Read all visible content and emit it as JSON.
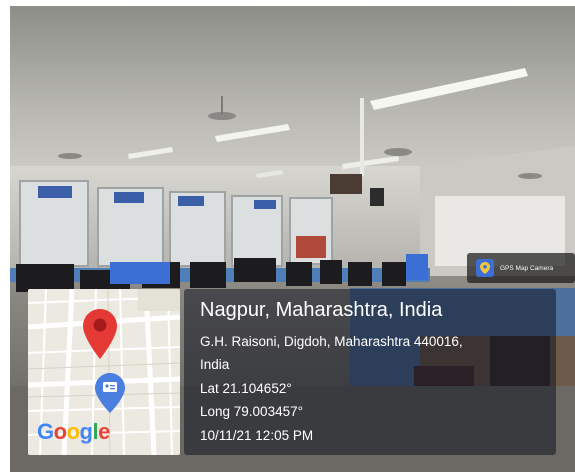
{
  "camera_badge": {
    "label": "GPS Map Camera",
    "icon": "gps-map-camera-icon",
    "accent": "#3b6fd6"
  },
  "map": {
    "brand": "Google",
    "pin_color": "#e53935",
    "place_marker_color": "#4a7fe0"
  },
  "location": {
    "title": "Nagpur, Maharashtra, India",
    "address_line1": "G.H. Raisoni, Digdoh, Maharashtra 440016,",
    "address_line2": "India",
    "latitude": "Lat 21.104652°",
    "longitude": "Long 79.003457°",
    "datetime": "10/11/21 12:05 PM"
  }
}
